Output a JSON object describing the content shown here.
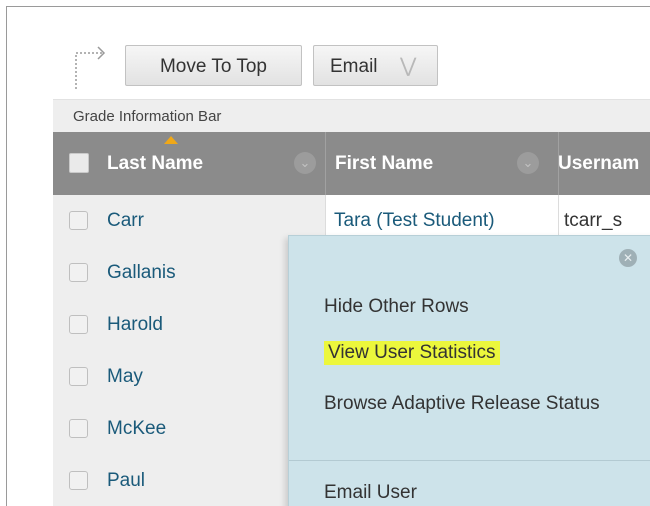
{
  "toolbar": {
    "move_to_top": "Move To Top",
    "email": "Email"
  },
  "info_bar": "Grade Information Bar",
  "columns": {
    "last_name": "Last Name",
    "first_name": "First Name",
    "username": "Usernam"
  },
  "rows": [
    {
      "last": "Carr",
      "first": "Tara (Test Student)",
      "user": "tcarr_s"
    },
    {
      "last": "Gallanis"
    },
    {
      "last": "Harold"
    },
    {
      "last": "May"
    },
    {
      "last": "McKee"
    },
    {
      "last": "Paul"
    }
  ],
  "context_menu": {
    "hide_other_rows": "Hide Other Rows",
    "view_user_statistics": "View User Statistics",
    "browse_adaptive_release_status": "Browse Adaptive Release Status",
    "email_user": "Email User"
  },
  "colors": {
    "header_bg": "#8b8b8b",
    "menu_bg": "#cde3ea",
    "highlight": "#ecf73c",
    "link": "#1a5a7a",
    "sort_indicator": "#f0a818"
  }
}
